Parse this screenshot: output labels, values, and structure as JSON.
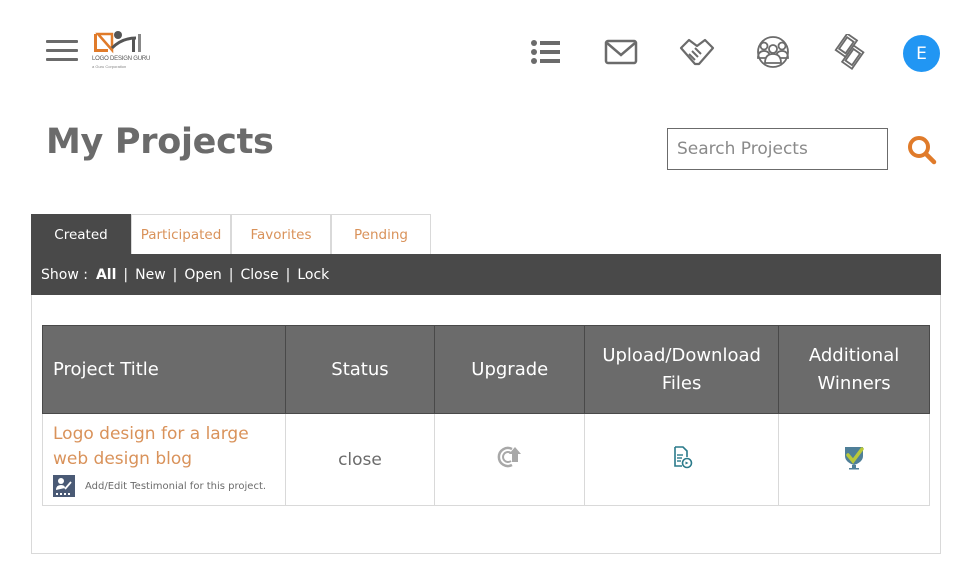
{
  "header": {
    "logo": {
      "name": "LOGO DESIGN GURU",
      "tagline": "a Guru Corporation"
    },
    "nav_icons": [
      "list-icon",
      "mail-icon",
      "handshake-icon",
      "team-icon",
      "money-icon"
    ],
    "avatar_initial": "E",
    "avatar_color": "#2196f3"
  },
  "page": {
    "title": "My Projects",
    "search": {
      "placeholder": "Search Projects",
      "value": ""
    }
  },
  "tabs": [
    {
      "label": "Created",
      "active": true
    },
    {
      "label": "Participated",
      "active": false
    },
    {
      "label": "Favorites",
      "active": false
    },
    {
      "label": "Pending",
      "active": false
    }
  ],
  "filters": {
    "label": "Show :",
    "items": [
      "All",
      "New",
      "Open",
      "Close",
      "Lock"
    ],
    "active": "All"
  },
  "table": {
    "columns": [
      "Project Title",
      "Status",
      "Upgrade",
      "Upload/Download Files",
      "Additional Winners"
    ],
    "columns_lines": [
      [
        "Project Title"
      ],
      [
        "Status"
      ],
      [
        "Upgrade"
      ],
      [
        "Upload/Download",
        "Files"
      ],
      [
        "Additional",
        "Winners"
      ]
    ],
    "rows": [
      {
        "title": "Logo design for a large web design blog",
        "testimonial_link": "Add/Edit Testimonial for this project.",
        "status": "close",
        "upgrade_icon": "upgrade-icon",
        "files_icon": "file-download-icon",
        "winners_icon": "winner-badge-icon"
      }
    ]
  },
  "colors": {
    "accent": "#d9925a",
    "dark_bar": "#494949",
    "header_gray": "#6b6b6b"
  }
}
